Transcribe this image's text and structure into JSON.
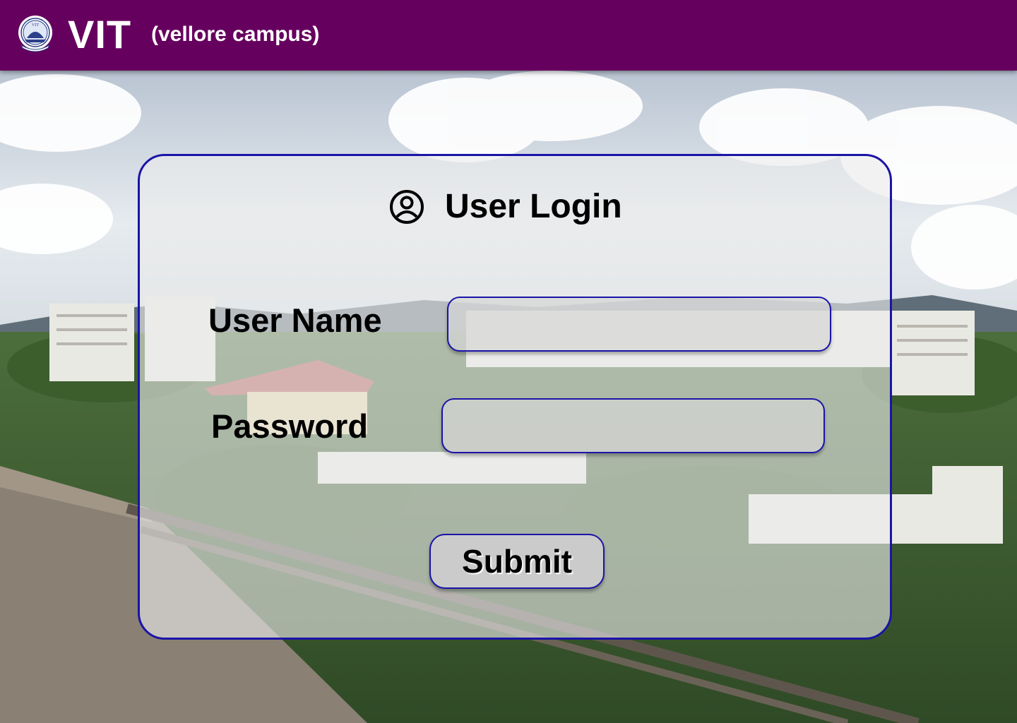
{
  "header": {
    "brand": "VIT",
    "campus": "(vellore campus)",
    "logo_icon": "vit-seal-logo",
    "logo_text": "VIT",
    "background_color": "#66005e"
  },
  "login": {
    "title": "User Login",
    "title_icon": "user-circle-icon",
    "username_label": "User Name",
    "password_label": "Password",
    "username_value": "",
    "password_value": "",
    "submit_label": "Submit",
    "accent_color": "#1a14a8"
  },
  "background": {
    "icon": "campus-photo"
  }
}
